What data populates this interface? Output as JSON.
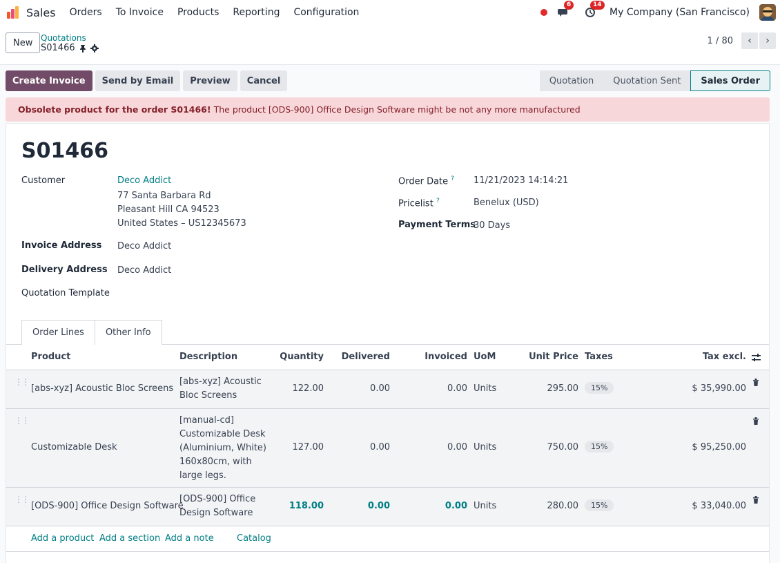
{
  "nav": {
    "app_name": "Sales",
    "menu": [
      "Orders",
      "To Invoice",
      "Products",
      "Reporting",
      "Configuration"
    ],
    "messages_badge": "6",
    "activities_badge": "14",
    "company": "My Company (San Francisco)"
  },
  "control": {
    "new_label": "New",
    "breadcrumb": "Quotations",
    "record": "S01466",
    "pager": "1 / 80"
  },
  "actions": {
    "create_invoice": "Create Invoice",
    "send_email": "Send by Email",
    "preview": "Preview",
    "cancel": "Cancel"
  },
  "stages": [
    "Quotation",
    "Quotation Sent",
    "Sales Order"
  ],
  "alert": {
    "bold": "Obsolete product for the order S01466!",
    "text": "The product [ODS-900] Office Design Software might be not any more manufactured"
  },
  "form": {
    "title": "S01466",
    "customer_label": "Customer",
    "customer_name": "Deco Addict",
    "address_1": "77 Santa Barbara Rd",
    "address_2": "Pleasant Hill CA 94523",
    "address_3": "United States – US12345673",
    "invoice_label": "Invoice Address",
    "invoice_value": "Deco Addict",
    "delivery_label": "Delivery Address",
    "delivery_value": "Deco Addict",
    "template_label": "Quotation Template",
    "order_date_label": "Order Date",
    "order_date_value": "11/21/2023 14:14:21",
    "pricelist_label": "Pricelist",
    "pricelist_value": "Benelux (USD)",
    "terms_label": "Payment Terms",
    "terms_value": "30 Days",
    "help_mark": "?"
  },
  "tabs": [
    "Order Lines",
    "Other Info"
  ],
  "table": {
    "headers": {
      "product": "Product",
      "description": "Description",
      "quantity": "Quantity",
      "delivered": "Delivered",
      "invoiced": "Invoiced",
      "uom": "UoM",
      "unit_price": "Unit Price",
      "taxes": "Taxes",
      "tax_excl": "Tax excl."
    },
    "rows": [
      {
        "product": "[abs-xyz] Acoustic Bloc Screens",
        "description": [
          "[abs-xyz] Acoustic",
          "Bloc Screens"
        ],
        "quantity": "122.00",
        "delivered": "0.00",
        "invoiced": "0.00",
        "uom": "Units",
        "unit_price": "295.00",
        "tax": "15%",
        "subtotal": "$ 35,990.00"
      },
      {
        "product": "Customizable Desk",
        "description": [
          "[manual-cd]",
          "Customizable Desk",
          "(Aluminium, White)",
          "160x80cm, with",
          "large legs."
        ],
        "quantity": "127.00",
        "delivered": "0.00",
        "invoiced": "0.00",
        "uom": "Units",
        "unit_price": "750.00",
        "tax": "15%",
        "subtotal": "$ 95,250.00"
      },
      {
        "product": "[ODS-900] Office Design Software",
        "description": [
          "[ODS-900] Office",
          "Design Software"
        ],
        "quantity": "118.00",
        "delivered": "0.00",
        "invoiced": "0.00",
        "uom": "Units",
        "unit_price": "280.00",
        "tax": "15%",
        "subtotal": "$ 33,040.00"
      }
    ],
    "add_product": "Add a product",
    "add_section": "Add a section",
    "add_note": "Add a note",
    "catalog": "Catalog"
  }
}
